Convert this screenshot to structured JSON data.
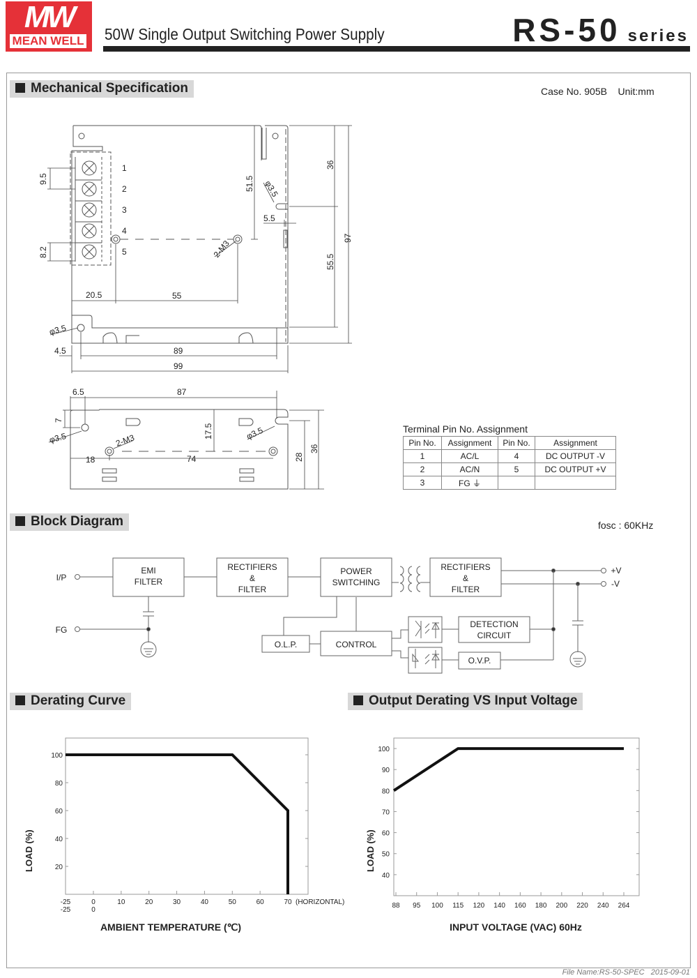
{
  "header": {
    "logo_mark": "MW",
    "logo_name": "MEAN WELL",
    "subtitle": "50W Single Output Switching Power Supply",
    "model": "RS-50",
    "model_suffix": "series",
    "brand_color": "#e53138"
  },
  "mechanical": {
    "title": "Mechanical Specification",
    "case_info": "Case No. 905B",
    "unit": "Unit:mm",
    "top_view": {
      "terminal_numbers": [
        "1",
        "2",
        "3",
        "4",
        "5"
      ],
      "dims": {
        "pitch_a": "9.5",
        "pitch_b": "8.2",
        "d1": "20.5",
        "d2": "55",
        "d3": "51.5",
        "hole1": "φ3.5",
        "hole2": "φ3.5",
        "screw": "2-M3",
        "d4": "5.5",
        "d5": "36",
        "d6": "55.5",
        "d7": "97",
        "d8": "4.5",
        "d9": "89",
        "d10": "99"
      }
    },
    "side_view": {
      "dims": {
        "a": "6.5",
        "b": "87",
        "c": "7",
        "hole1": "φ3.5",
        "screw": "2-M3",
        "d": "17.5",
        "hole2": "φ3.5",
        "e": "18",
        "f": "74",
        "g": "28",
        "h": "36"
      }
    },
    "pin_table": {
      "title": "Terminal Pin No.  Assignment",
      "headers": [
        "Pin No.",
        "Assignment",
        "Pin No.",
        "Assignment"
      ],
      "rows": [
        [
          "1",
          "AC/L",
          "4",
          "DC OUTPUT -V"
        ],
        [
          "2",
          "AC/N",
          "5",
          "DC OUTPUT +V"
        ],
        [
          "3",
          "FG ⏚",
          "",
          ""
        ]
      ]
    }
  },
  "block_diagram": {
    "title": "Block Diagram",
    "fosc": "fosc : 60KHz",
    "labels": {
      "ip": "I/P",
      "fg": "FG",
      "pos_v": "+V",
      "neg_v": "-V",
      "emi_1": "EMI",
      "emi_2": "FILTER",
      "rect1_1": "RECTIFIERS",
      "rect1_2": "&",
      "rect1_3": "FILTER",
      "ps_1": "POWER",
      "ps_2": "SWITCHING",
      "rect2_1": "RECTIFIERS",
      "rect2_2": "&",
      "rect2_3": "FILTER",
      "olp": "O.L.P.",
      "control": "CONTROL",
      "det_1": "DETECTION",
      "det_2": "CIRCUIT",
      "ovp": "O.V.P."
    }
  },
  "chart_data": [
    {
      "type": "line",
      "title": "Derating Curve",
      "xlabel": "AMBIENT TEMPERATURE (℃)",
      "ylabel": "LOAD (%)",
      "x_tick_labels": [
        "-25",
        "0",
        "10",
        "20",
        "30",
        "40",
        "50",
        "60",
        "70"
      ],
      "x_tick_labels_row2": [
        "-25",
        "0"
      ],
      "x_extra_label": "(HORIZONTAL)",
      "y_ticks": [
        20,
        40,
        60,
        80,
        100
      ],
      "ylim": [
        0,
        112
      ],
      "grid": false,
      "series": [
        {
          "name": "HORIZONTAL",
          "x": [
            -25,
            50,
            70,
            70
          ],
          "y": [
            100,
            100,
            60,
            0
          ]
        }
      ]
    },
    {
      "type": "line",
      "title": "Output Derating VS Input Voltage",
      "xlabel": "INPUT VOLTAGE (VAC) 60Hz",
      "ylabel": "LOAD (%)",
      "categories": [
        "88",
        "95",
        "100",
        "115",
        "120",
        "140",
        "160",
        "180",
        "200",
        "220",
        "240",
        "264"
      ],
      "y_ticks": [
        40,
        50,
        60,
        70,
        80,
        90,
        100
      ],
      "ylim": [
        30,
        105
      ],
      "grid": false,
      "series": [
        {
          "name": "Load",
          "x": [
            "88",
            "115",
            "264"
          ],
          "y": [
            80,
            100,
            100
          ]
        }
      ]
    }
  ],
  "footer": {
    "file_name": "File Name:RS-50-SPEC",
    "date": "2015-09-01"
  }
}
